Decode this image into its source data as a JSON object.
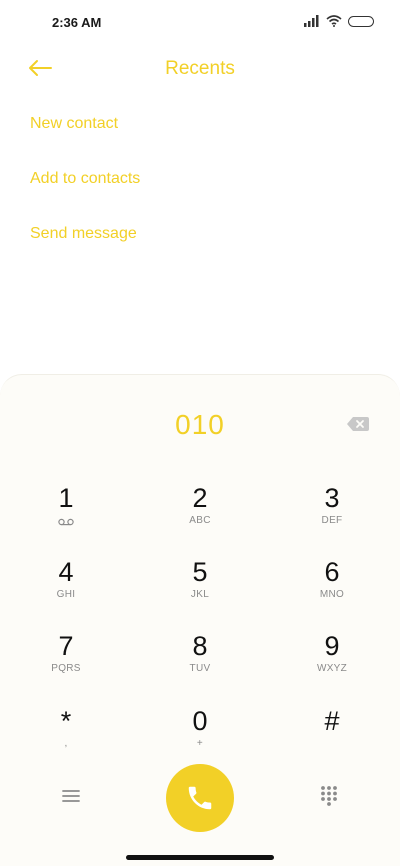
{
  "status_bar": {
    "time": "2:36 AM"
  },
  "header": {
    "title": "Recents"
  },
  "options": [
    {
      "label": "New contact"
    },
    {
      "label": "Add to contacts"
    },
    {
      "label": "Send message"
    }
  ],
  "dialer": {
    "number": "010",
    "keys": [
      {
        "digit": "1",
        "letters": ""
      },
      {
        "digit": "2",
        "letters": "ABC"
      },
      {
        "digit": "3",
        "letters": "DEF"
      },
      {
        "digit": "4",
        "letters": "GHI"
      },
      {
        "digit": "5",
        "letters": "JKL"
      },
      {
        "digit": "6",
        "letters": "MNO"
      },
      {
        "digit": "7",
        "letters": "PQRS"
      },
      {
        "digit": "8",
        "letters": "TUV"
      },
      {
        "digit": "9",
        "letters": "WXYZ"
      },
      {
        "digit": "*",
        "letters": ","
      },
      {
        "digit": "0",
        "letters": "+"
      },
      {
        "digit": "#",
        "letters": ""
      }
    ]
  },
  "colors": {
    "accent": "#f2d027",
    "panel_bg": "#fdfcf8"
  },
  "icons": [
    "back-arrow-icon",
    "backspace-icon",
    "voicemail-icon",
    "menu-icon",
    "phone-icon",
    "dialpad-icon",
    "wifi-icon",
    "signal-icon",
    "battery-icon"
  ]
}
